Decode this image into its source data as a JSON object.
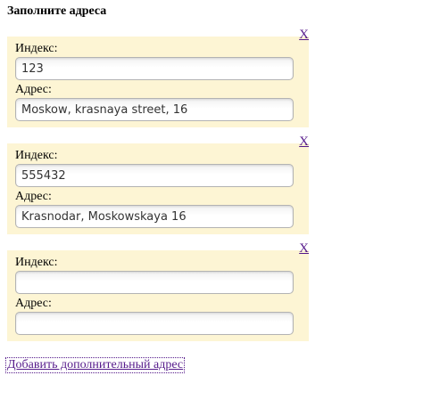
{
  "form": {
    "title": "Заполните адреса",
    "remove_label": "X",
    "index_label": "Индекс:",
    "address_label": "Адрес:",
    "add_link_label": "Добавить дополнительный адрес",
    "addresses": [
      {
        "index": "123",
        "address": "Moskow, krasnaya street, 16"
      },
      {
        "index": "555432",
        "address": "Krasnodar, Moskowskaya 16"
      },
      {
        "index": "",
        "address": ""
      }
    ]
  },
  "colors": {
    "block_background": "#fdf5d4",
    "link": "#551a8b"
  }
}
